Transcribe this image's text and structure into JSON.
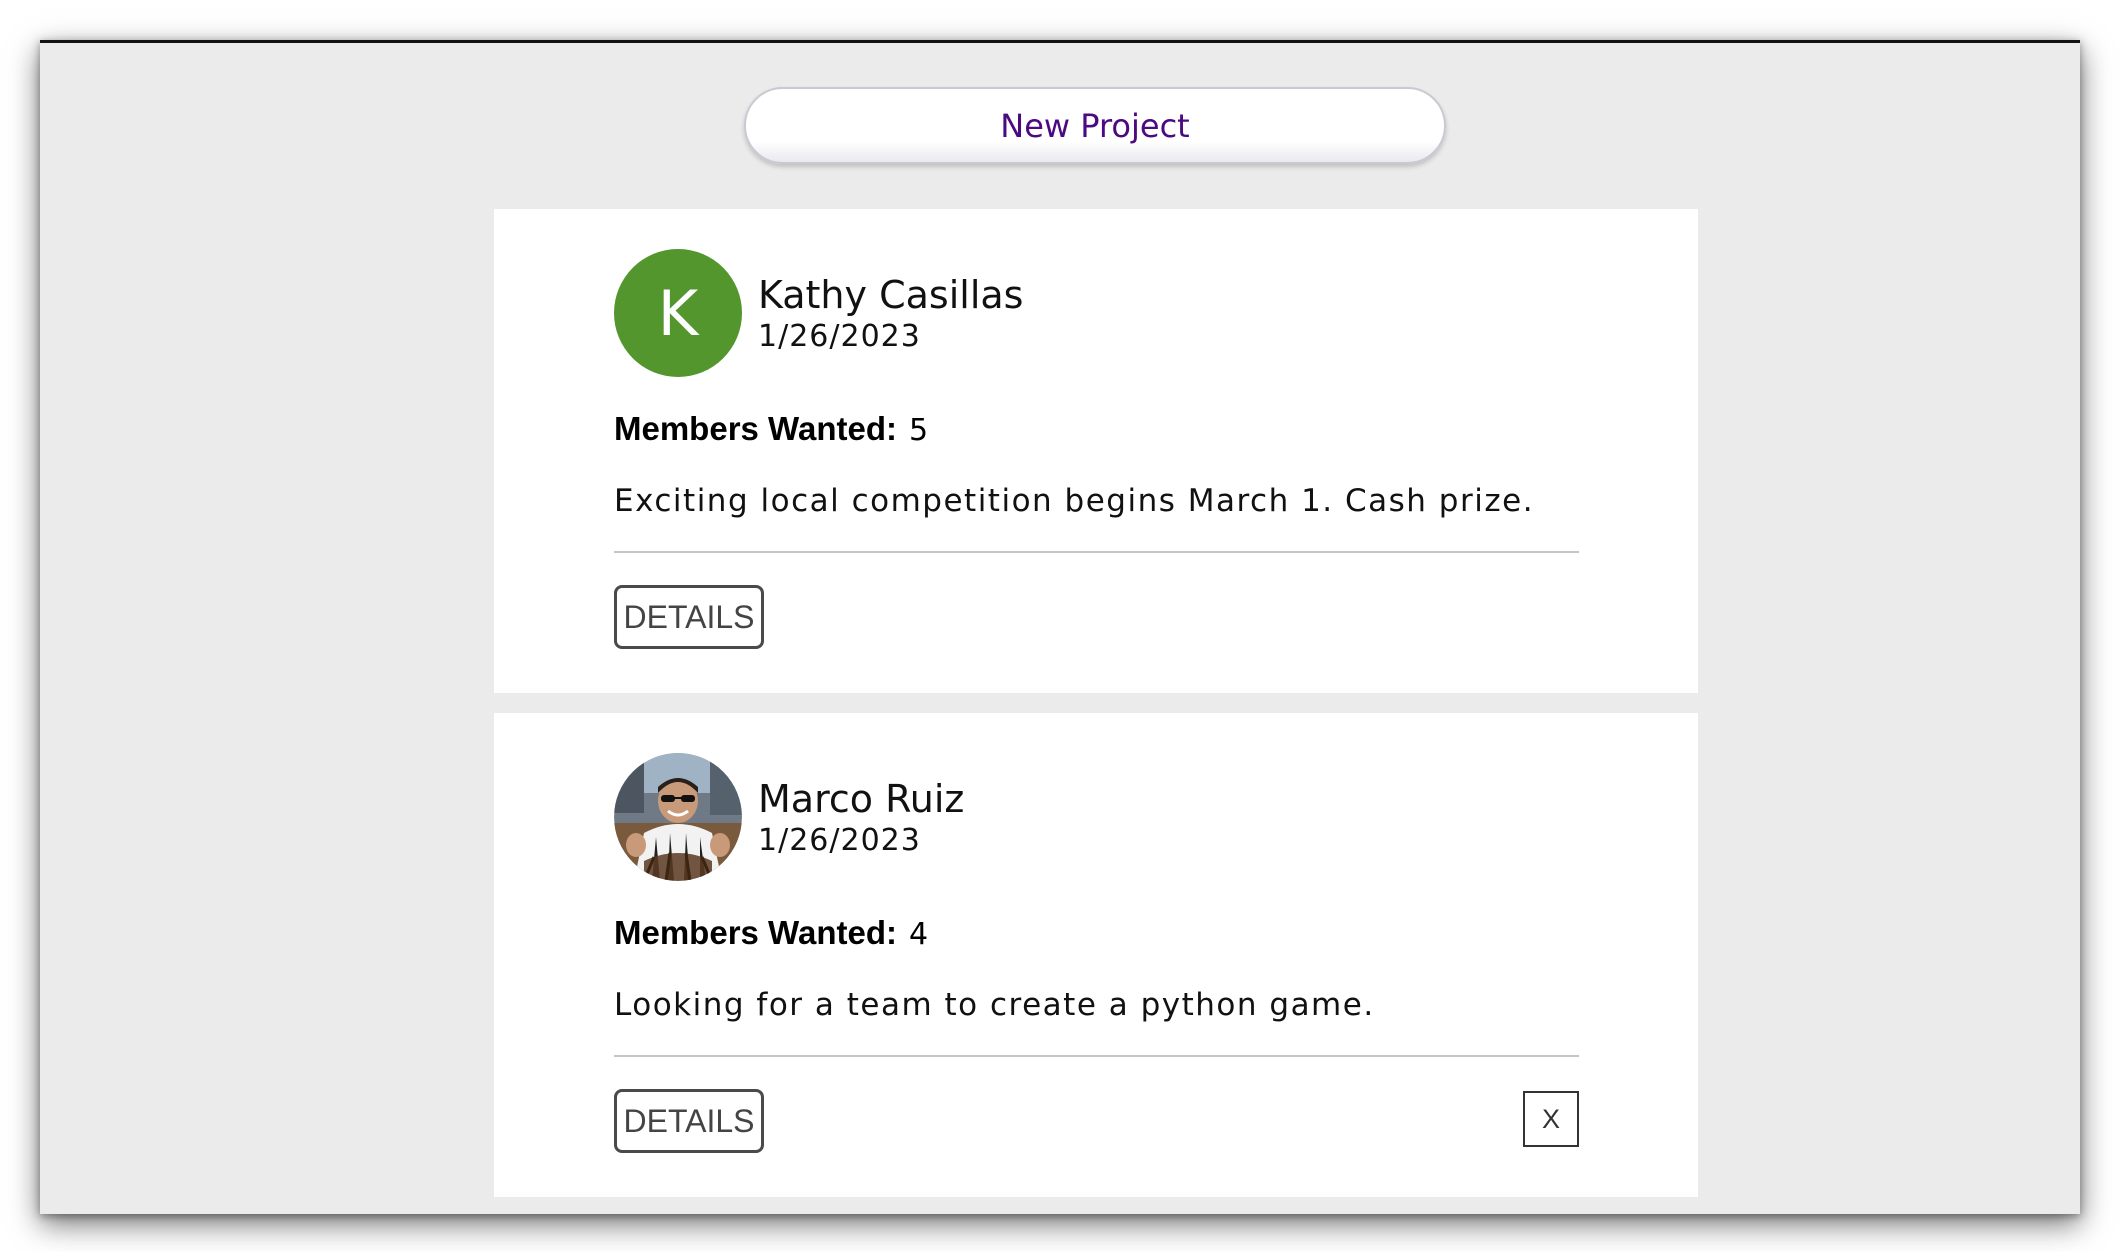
{
  "toolbar": {
    "new_project_label": "New Project"
  },
  "colors": {
    "accent_text": "#4b0a80",
    "avatar_green": "#54962e",
    "background": "#ebebeb"
  },
  "posts": [
    {
      "author": "Kathy Casillas",
      "date": "1/26/2023",
      "avatar_letter": "K",
      "members_label": "Members Wanted:",
      "members_value": "5",
      "description": "Exciting local competition begins March 1. Cash prize.",
      "details_label": "DETAILS"
    },
    {
      "author": "Marco Ruiz",
      "date": "1/26/2023",
      "avatar_icon": "user-photo",
      "members_label": "Members Wanted:",
      "members_value": "4",
      "description": "Looking for a team to create a python game.",
      "details_label": "DETAILS",
      "delete_label": "X"
    }
  ]
}
